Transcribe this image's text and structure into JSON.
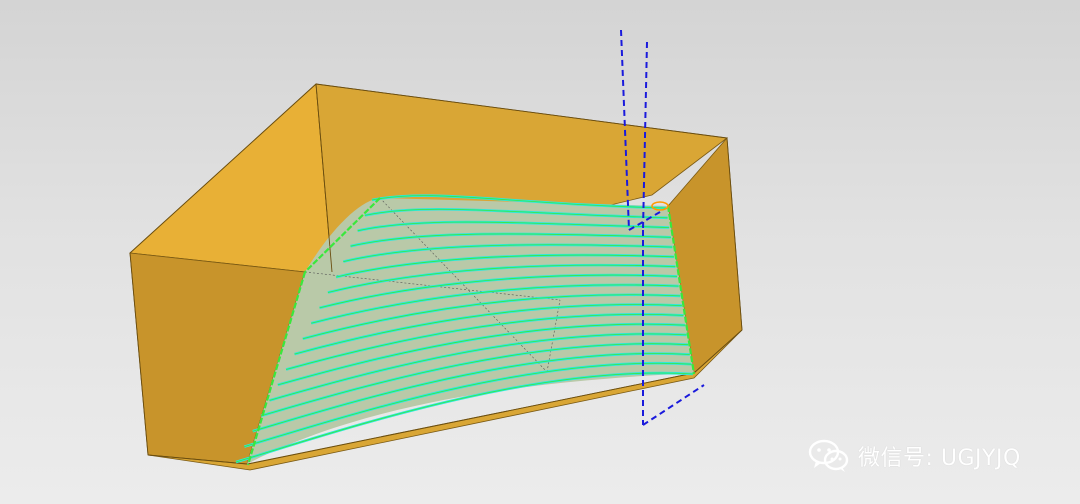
{
  "scene": {
    "colors": {
      "background_top": "#d4d4d4",
      "background_bottom": "#ececec",
      "block_light": "#e8b036",
      "block_mid": "#d9a635",
      "block_dark": "#c8942b",
      "block_edge": "#7a5a14",
      "toolpath_cyan": "#2ee8dc",
      "toolpath_green": "#39e83c",
      "tool_axis_blue": "#1a1adc",
      "cut_marker_orange": "#ff9a00"
    },
    "toolpath_pass_count": 18
  },
  "watermark": {
    "icon": "wechat-icon",
    "text": "微信号: UGJYJQ"
  }
}
